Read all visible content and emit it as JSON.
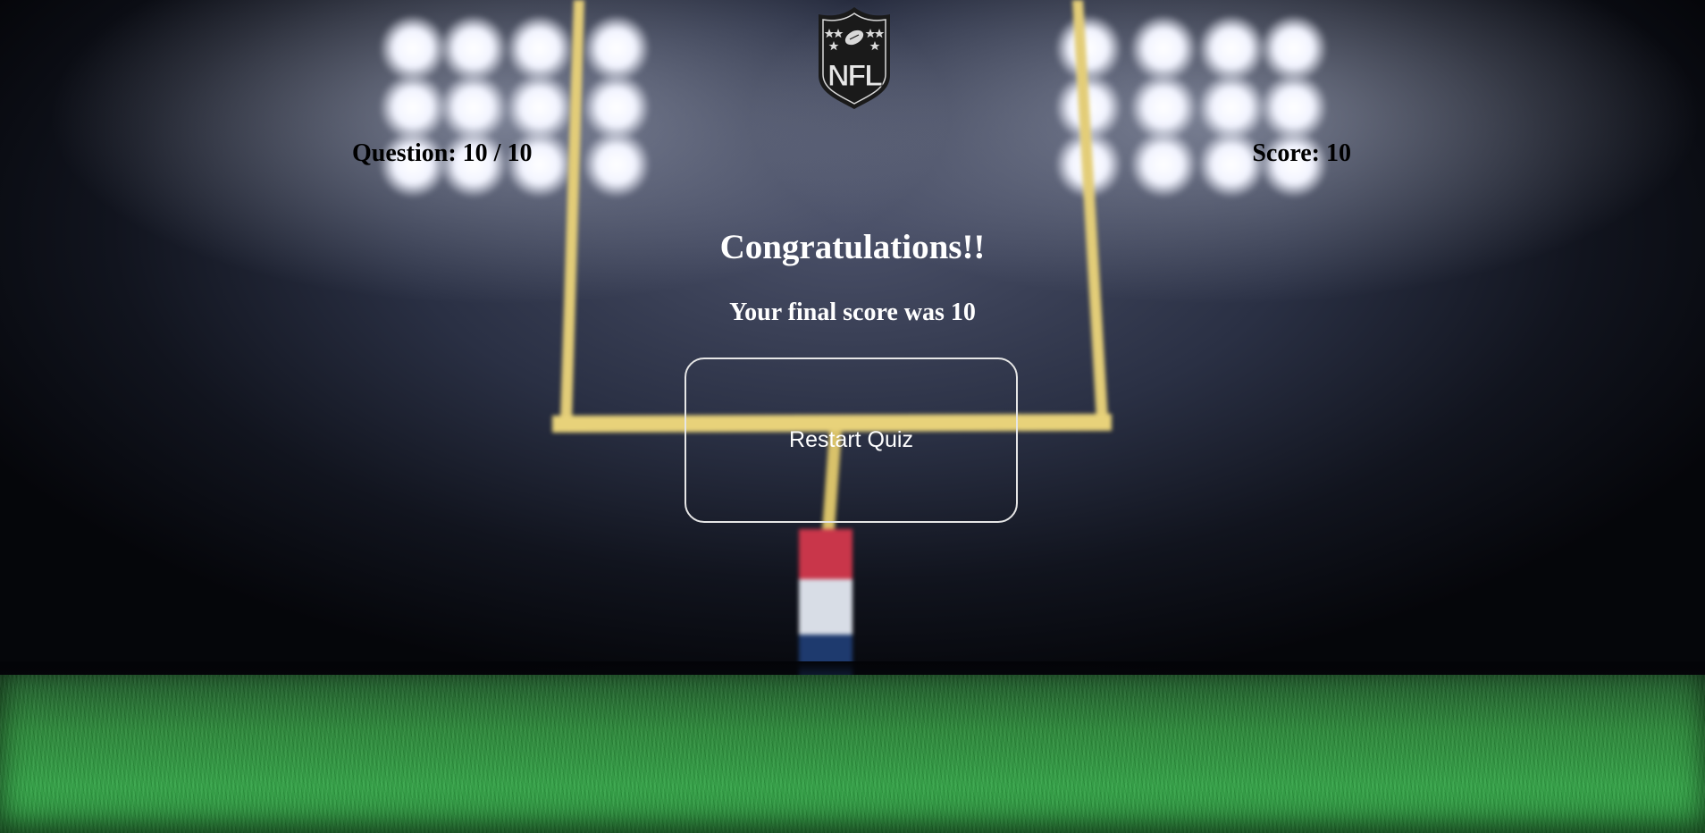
{
  "header": {
    "logo_icon": "nfl-shield-logo",
    "logo_text": "NFL",
    "question_label": "Question: 10 / 10",
    "score_label": "Score: 10"
  },
  "result": {
    "headline": "Congratulations!!",
    "final_score_text": "Your final score was 10",
    "restart_label": "Restart Quiz"
  },
  "colors": {
    "text_light": "#ffffff",
    "text_dark": "#000000",
    "goalpost": "#e8d27a",
    "turf": "#2c8a3a",
    "sky": "#2a3044"
  }
}
